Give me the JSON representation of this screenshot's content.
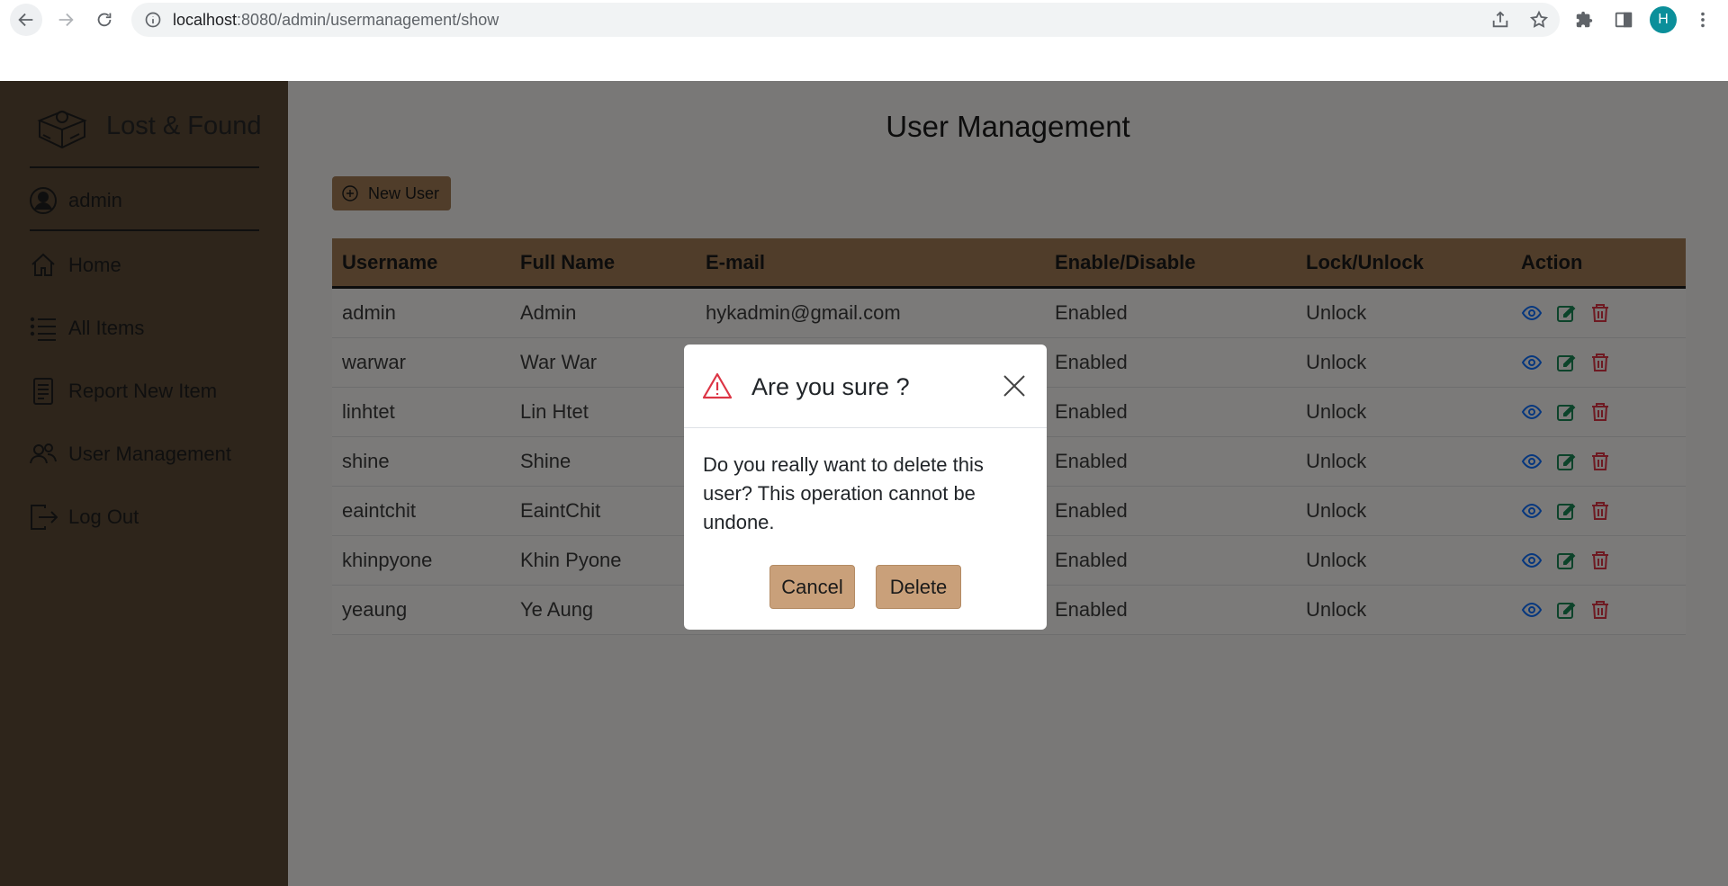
{
  "browser": {
    "url_host": "localhost",
    "url_rest": ":8080/admin/usermanagement/show",
    "profile_initial": "H"
  },
  "sidebar": {
    "brand": "Lost & Found",
    "user": "admin",
    "items": [
      {
        "label": "Home",
        "icon": "home-icon"
      },
      {
        "label": "All Items",
        "icon": "list-icon"
      },
      {
        "label": "Report New Item",
        "icon": "document-icon"
      },
      {
        "label": "User Management",
        "icon": "people-icon"
      },
      {
        "label": "Log Out",
        "icon": "logout-icon"
      }
    ]
  },
  "main": {
    "title": "User Management",
    "new_user_label": "New User",
    "table": {
      "headers": [
        "Username",
        "Full Name",
        "E-mail",
        "Enable/Disable",
        "Lock/Unlock",
        "Action"
      ],
      "rows": [
        {
          "username": "admin",
          "full_name": "Admin",
          "email": "hykadmin@gmail.com",
          "enabled": "Enabled",
          "lock": "Unlock"
        },
        {
          "username": "warwar",
          "full_name": "War War",
          "email": "",
          "enabled": "Enabled",
          "lock": "Unlock"
        },
        {
          "username": "linhtet",
          "full_name": "Lin Htet",
          "email": "",
          "enabled": "Enabled",
          "lock": "Unlock"
        },
        {
          "username": "shine",
          "full_name": "Shine",
          "email": "",
          "enabled": "Enabled",
          "lock": "Unlock"
        },
        {
          "username": "eaintchit",
          "full_name": "EaintChit",
          "email": "",
          "enabled": "Enabled",
          "lock": "Unlock"
        },
        {
          "username": "khinpyone",
          "full_name": "Khin Pyone",
          "email": "",
          "enabled": "Enabled",
          "lock": "Unlock"
        },
        {
          "username": "yeaung",
          "full_name": "Ye Aung",
          "email": "",
          "enabled": "Enabled",
          "lock": "Unlock"
        }
      ]
    }
  },
  "modal": {
    "title": "Are you sure ?",
    "body": "Do you really want to delete this user? This operation cannot be undone.",
    "cancel_label": "Cancel",
    "delete_label": "Delete"
  },
  "colors": {
    "sidebar_bg": "#5c4a36",
    "accent": "#a07b55",
    "button": "#c9a07a",
    "danger": "#dc3545"
  }
}
